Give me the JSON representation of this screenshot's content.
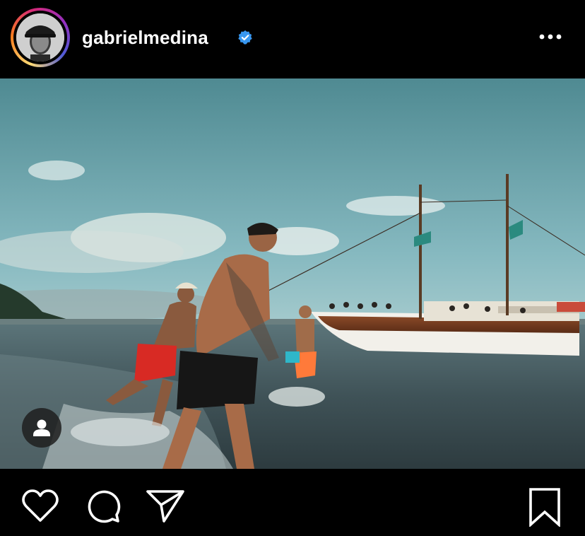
{
  "post": {
    "username": "gabrielmedina",
    "verified": true,
    "menu_icon": "more-horizontal-icon",
    "photo_description_icon": "user-tag-icon"
  },
  "actions": {
    "like_icon": "heart-icon",
    "comment_icon": "comment-icon",
    "share_icon": "send-icon",
    "save_icon": "bookmark-icon"
  },
  "colors": {
    "background": "#000000",
    "verified_badge": "#3897f0",
    "text": "#ffffff"
  }
}
